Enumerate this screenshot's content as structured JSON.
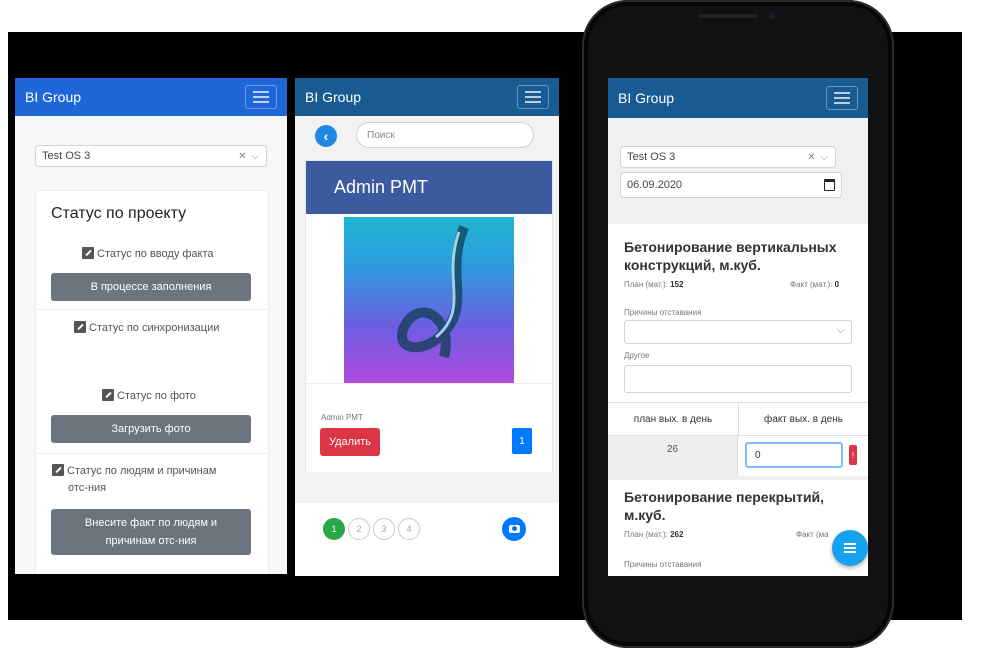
{
  "colors": {
    "nav_left": "#1f66d8",
    "nav_mid": "#185a92",
    "nav_right": "#185a92",
    "admin_header": "#3c5aa0",
    "danger": "#dc3545",
    "primary": "#007bff",
    "success": "#28a745",
    "fab": "#17a2f0"
  },
  "left": {
    "brand": "BI Group",
    "select_value": "Test OS 3",
    "card_title": "Статус по проекту",
    "status_fact": "Статус по вводу факта",
    "btn_fill": "В процессе заполнения",
    "status_sync": "Статус по синхронизации",
    "status_photo": "Статус по фото",
    "btn_upload": "Загрузить фото",
    "status_people_1": "Статус по людям и причинам",
    "status_people_2": "отс-ния",
    "btn_people_1": "Внесите факт по людям и",
    "btn_people_2": "причинам отс-ния"
  },
  "mid": {
    "brand": "BI Group",
    "search_placeholder": "Поиск",
    "back_icon": "chevron-left-icon",
    "card_title": "Admin PMT",
    "caption": "Admin PMT",
    "btn_delete": "Удалить",
    "badge": "1",
    "pages": [
      "1",
      "2",
      "3",
      "4"
    ],
    "camera_icon": "camera-icon"
  },
  "right": {
    "brand": "BI Group",
    "select_value": "Test OS 3",
    "date_value": "06.09.2020",
    "section1_title_1": "Бетонирование вертикальных",
    "section1_title_2": "конструкций, м.куб.",
    "plan_label": "План (мат.):",
    "plan1_value": "152",
    "fact_label": "Факт (мат.):",
    "fact1_value": "0",
    "reasons_label": "Причины отставания",
    "other_label": "Другое",
    "th_plan": "план вых. в день",
    "th_fact": "факт вых. в день",
    "td_plan": "26",
    "td_fact_input": "0",
    "warn": "!",
    "section2_title_1": "Бетонирование перекрытий,",
    "section2_title_2": "м.куб.",
    "plan2_value": "262",
    "fact2_partial": "Факт (ма",
    "reasons_label_2": "Причины отставания"
  }
}
